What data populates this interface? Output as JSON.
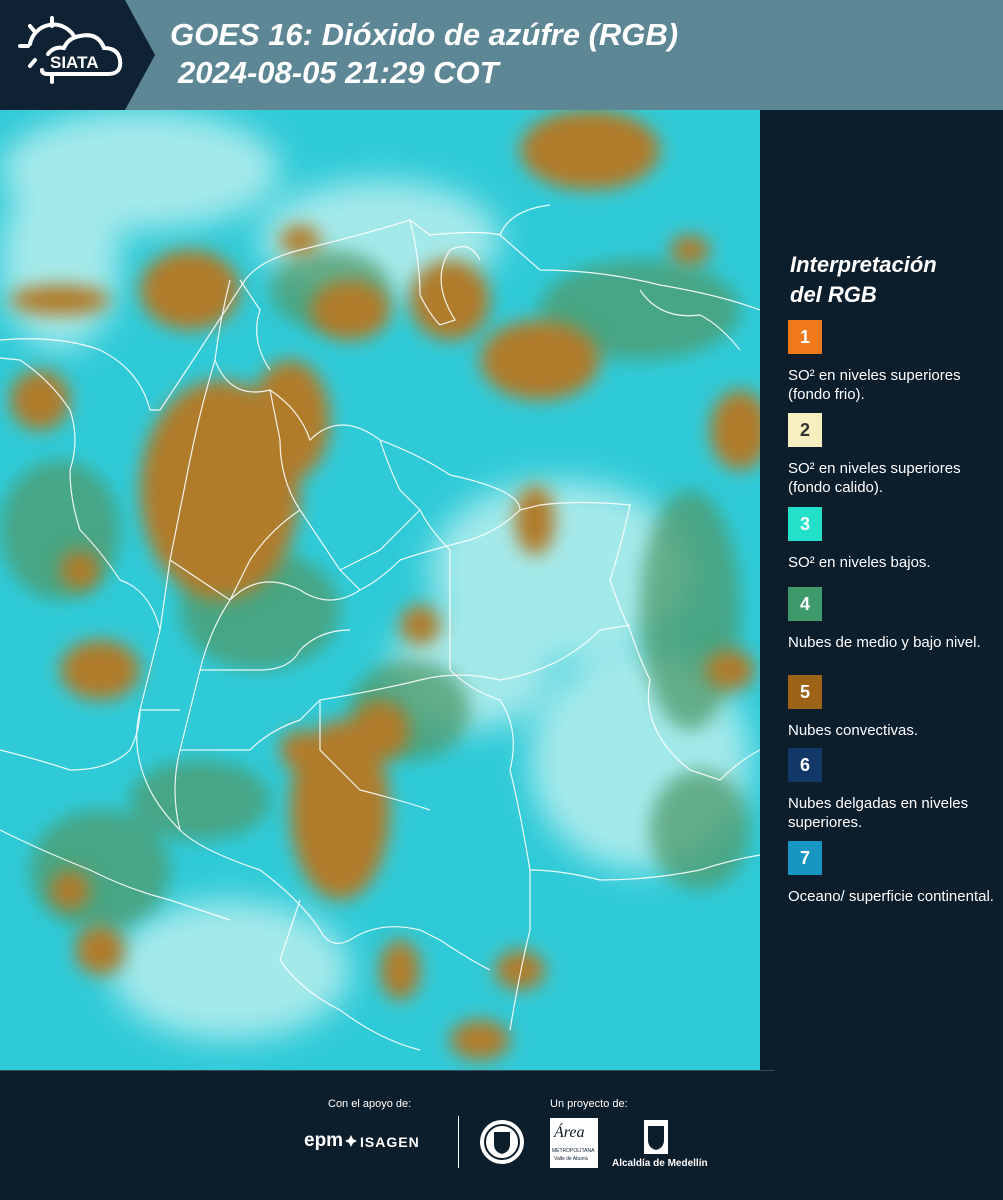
{
  "header": {
    "logo_text": "SIATA",
    "title_line1": "GOES 16: Dióxido de azúfre (RGB)",
    "title_line2": "2024-08-05 21:29 COT"
  },
  "legend": {
    "title_line1": "Interpretación",
    "title_line2": "del RGB",
    "items": [
      {
        "num": "1",
        "text": "SO² en niveles superiores (fondo frio).",
        "color": "#f07a1a",
        "numcolor": "#ffffff"
      },
      {
        "num": "2",
        "text": "SO² en niveles superiores (fondo calido).",
        "color": "#f7efbf",
        "numcolor": "#333333"
      },
      {
        "num": "3",
        "text": "SO² en niveles bajos.",
        "color": "#22e0c9",
        "numcolor": "#ffffff"
      },
      {
        "num": "4",
        "text": "Nubes de medio y bajo nivel.",
        "color": "#3e9a6a",
        "numcolor": "#ffffff"
      },
      {
        "num": "5",
        "text": "Nubes convectivas.",
        "color": "#9c6317",
        "numcolor": "#ffffff"
      },
      {
        "num": "6",
        "text": "Nubes delgadas en niveles superiores.",
        "color": "#12386a",
        "numcolor": "#ffffff"
      },
      {
        "num": "7",
        "text": "Oceano/ superficie continental.",
        "color": "#1696c0",
        "numcolor": "#ffffff"
      }
    ]
  },
  "footer": {
    "support_label": "Con el apoyo de:",
    "project_label": "Un proyecto de:",
    "epm": "epm",
    "isagen": "ISAGEN",
    "metropolitana": "METROPOLITANA",
    "area": "Área",
    "valle": "Valle de Aburrá",
    "alcaldia": "Alcaldía de Medellín"
  }
}
